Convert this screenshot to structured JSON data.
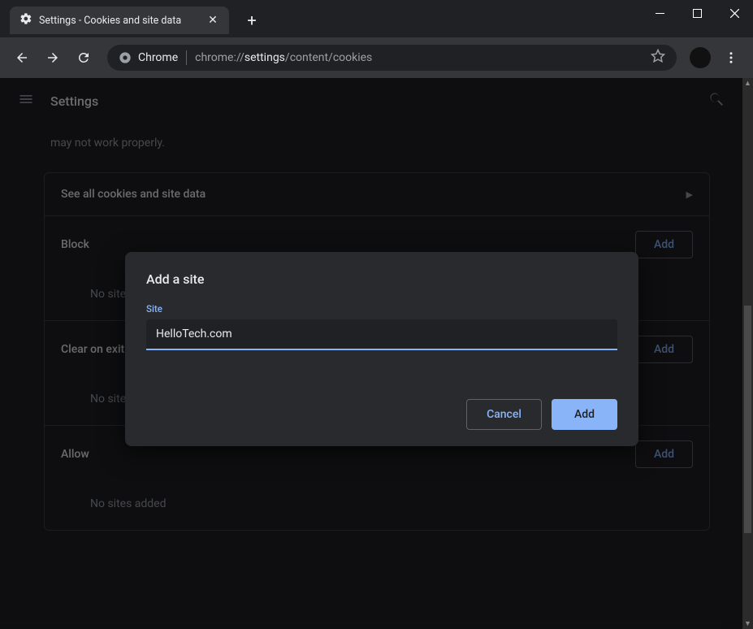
{
  "window": {
    "tab_title": "Settings - Cookies and site data"
  },
  "omnibox": {
    "scheme_label": "Chrome",
    "url_prefix": "chrome://",
    "url_highlight": "settings",
    "url_suffix": "/content/cookies"
  },
  "header": {
    "title": "Settings"
  },
  "content": {
    "truncated_line": "may not work properly.",
    "see_all_label": "See all cookies and site data",
    "sections": [
      {
        "title": "Block",
        "add_label": "Add",
        "empty_text": "No sites added"
      },
      {
        "title": "Clear on exit",
        "add_label": "Add",
        "empty_text": "No sites added"
      },
      {
        "title": "Allow",
        "add_label": "Add",
        "empty_text": "No sites added"
      }
    ]
  },
  "dialog": {
    "title": "Add a site",
    "field_label": "Site",
    "field_value": "HelloTech.com",
    "cancel_label": "Cancel",
    "add_label": "Add"
  }
}
